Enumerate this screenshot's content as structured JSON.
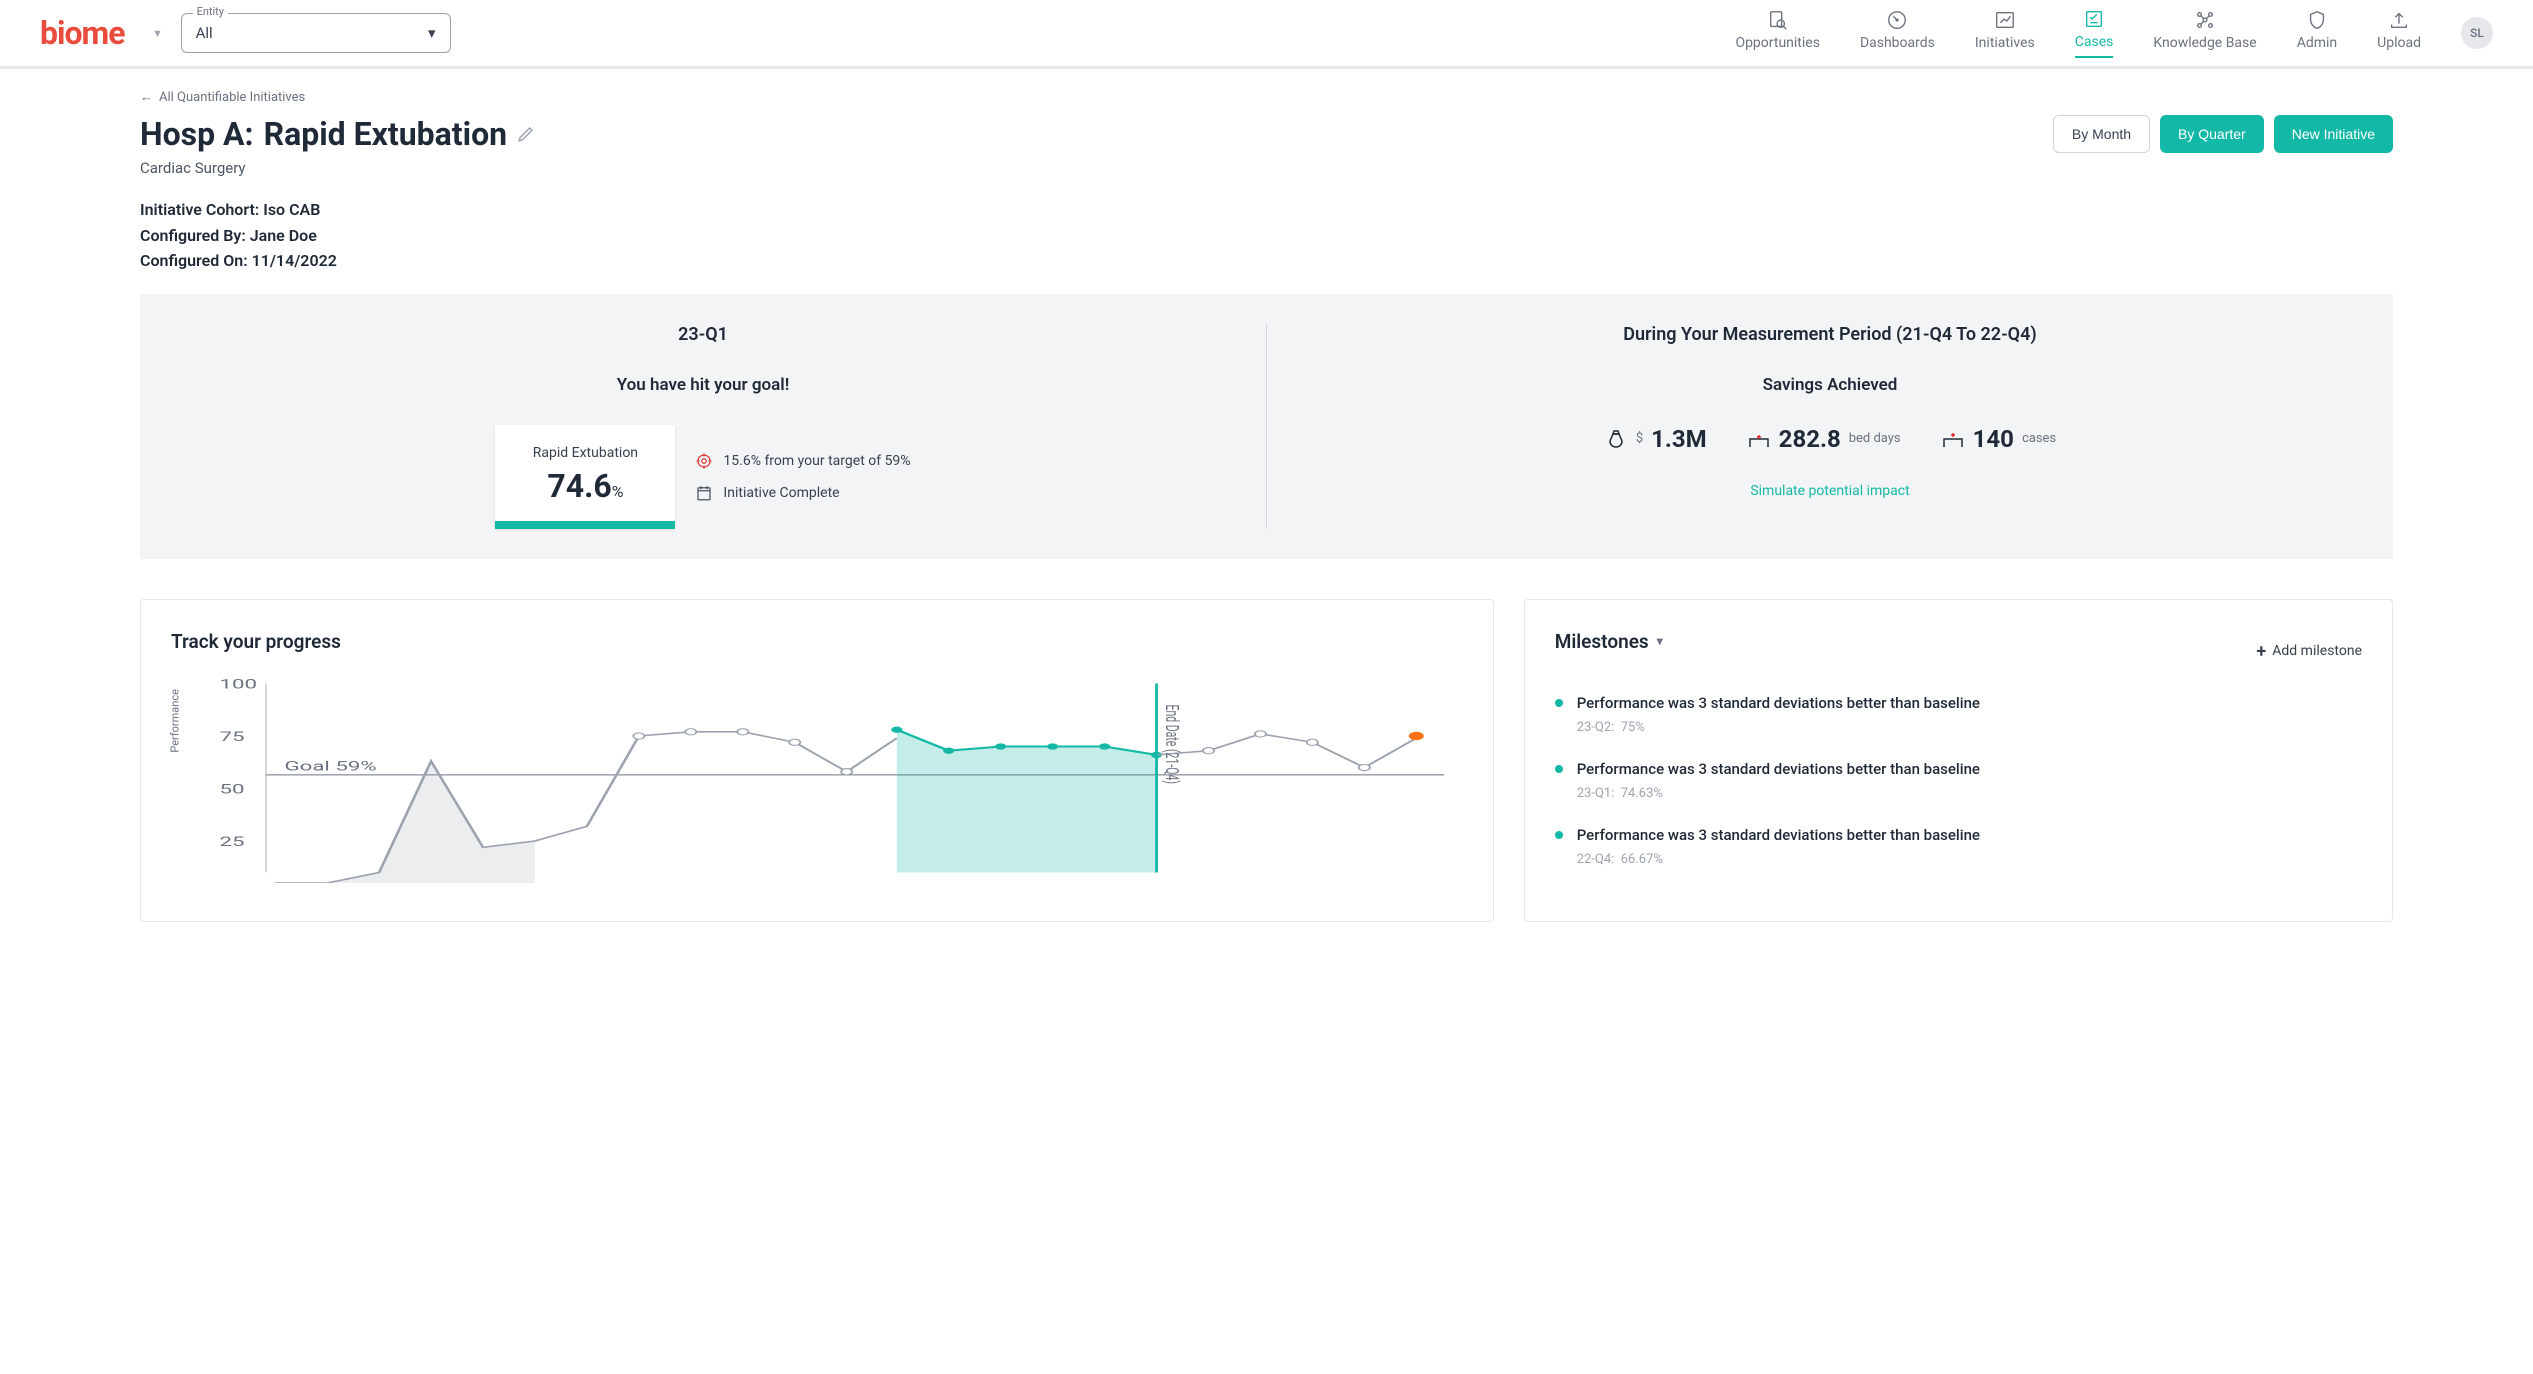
{
  "header": {
    "logo": "biome",
    "entity_label": "Entity",
    "entity_value": "All",
    "nav": [
      {
        "label": "Opportunities",
        "icon": "search"
      },
      {
        "label": "Dashboards",
        "icon": "gauge"
      },
      {
        "label": "Initiatives",
        "icon": "chart"
      },
      {
        "label": "Cases",
        "icon": "checklist",
        "active": true
      },
      {
        "label": "Knowledge Base",
        "icon": "network"
      },
      {
        "label": "Admin",
        "icon": "shield"
      },
      {
        "label": "Upload",
        "icon": "upload"
      }
    ],
    "avatar_initials": "SL"
  },
  "breadcrumb": "All Quantifiable Initiatives",
  "title_prefix": "Hosp A:",
  "title_main": "Rapid Extubation",
  "subtitle": "Cardiac Surgery",
  "buttons": {
    "by_month": "By Month",
    "by_quarter": "By Quarter",
    "new_initiative": "New Initiative"
  },
  "meta": {
    "cohort_label": "Initiative Cohort:",
    "cohort_value": "Iso CAB",
    "configured_by_label": "Configured By:",
    "configured_by_value": "Jane Doe",
    "configured_on_label": "Configured On:",
    "configured_on_value": "11/14/2022"
  },
  "stats_left": {
    "heading": "23-Q1",
    "subheading": "You have hit your goal!",
    "card_label": "Rapid Extubation",
    "card_value": "74.6",
    "card_pct": "%",
    "detail1": "15.6% from your target of 59%",
    "detail2": "Initiative Complete"
  },
  "stats_right": {
    "heading": "During Your Measurement Period (21-Q4 To 22-Q4)",
    "subheading": "Savings Achieved",
    "savings": [
      {
        "prefix": "$",
        "value": "1.3M",
        "label": ""
      },
      {
        "value": "282.8",
        "label": "bed days"
      },
      {
        "value": "140",
        "label": "cases"
      }
    ],
    "sim_link": "Simulate potential impact"
  },
  "progress": {
    "title": "Track your progress",
    "y_label": "Performance",
    "goal_label": "Goal 59%",
    "y_ticks": [
      "25",
      "50",
      "75",
      "100"
    ],
    "end_date_label": "End Date (21-Q4)"
  },
  "milestones": {
    "title": "Milestones",
    "add_label": "Add milestone",
    "items": [
      {
        "text": "Performance was 3 standard deviations better than baseline",
        "period": "23-Q2:",
        "value": "75%"
      },
      {
        "text": "Performance was 3 standard deviations better than baseline",
        "period": "23-Q1:",
        "value": "74.63%"
      },
      {
        "text": "Performance was 3 standard deviations better than baseline",
        "period": "22-Q4:",
        "value": "66.67%"
      }
    ]
  },
  "chart_data": {
    "type": "line",
    "ylabel": "Performance",
    "ylim": [
      0,
      100
    ],
    "goal": 59,
    "end_date_index": 13,
    "series": [
      {
        "name": "baseline",
        "color": "#9ca3af",
        "values": [
          5,
          5,
          10,
          63,
          22,
          25,
          32,
          75,
          77,
          77,
          72,
          58,
          74,
          null,
          null,
          null,
          null,
          null,
          null,
          null
        ]
      },
      {
        "name": "measurement",
        "color": "#14b8a6",
        "fill": true,
        "values": [
          null,
          null,
          null,
          null,
          null,
          null,
          null,
          null,
          null,
          null,
          null,
          null,
          78,
          68,
          70,
          70,
          70,
          66,
          null,
          null
        ]
      },
      {
        "name": "post",
        "color": "#9ca3af",
        "values": [
          null,
          null,
          null,
          null,
          null,
          null,
          null,
          null,
          null,
          null,
          null,
          null,
          null,
          null,
          null,
          null,
          null,
          66,
          68,
          76,
          72,
          60,
          74
        ]
      },
      {
        "name": "highlight",
        "color": "#f97316",
        "values": [
          null,
          null,
          null,
          null,
          null,
          null,
          null,
          null,
          null,
          null,
          null,
          null,
          null,
          null,
          null,
          null,
          null,
          null,
          null,
          null,
          null,
          null,
          75
        ]
      }
    ]
  }
}
